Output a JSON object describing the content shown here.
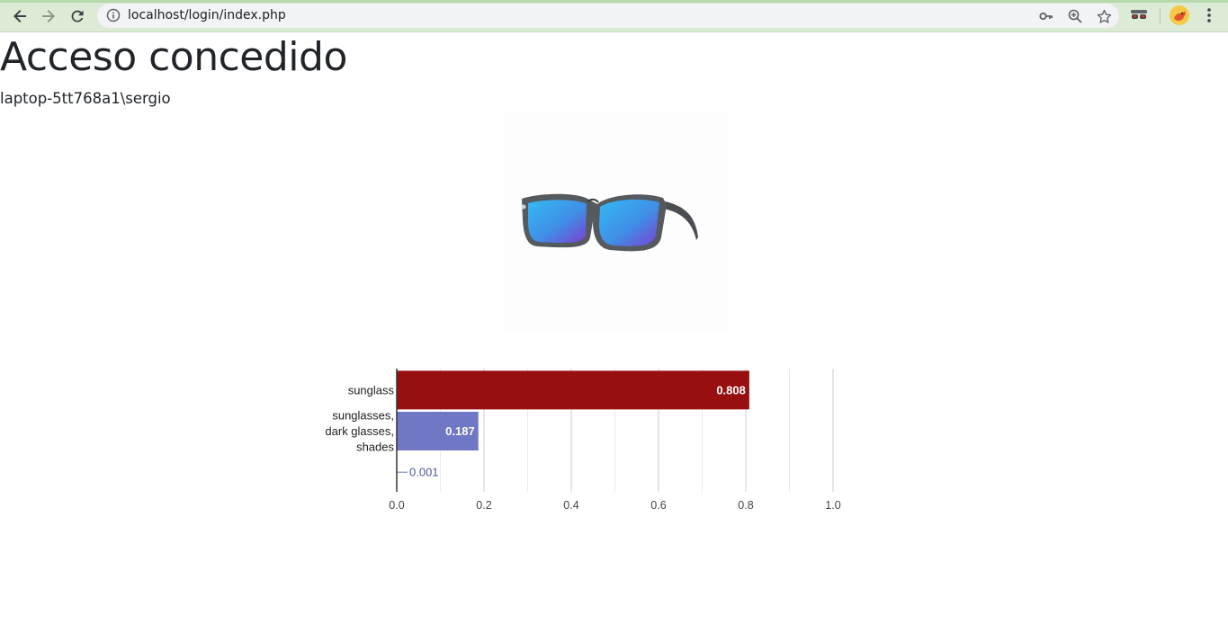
{
  "browser": {
    "url": "localhost/login/index.php",
    "icons": [
      "back-arrow-icon",
      "forward-arrow-icon",
      "reload-icon",
      "info-icon",
      "key-icon",
      "zoom-icon",
      "star-icon",
      "incognito-extension-icon",
      "profile-avatar-icon",
      "more-menu-icon"
    ]
  },
  "page": {
    "heading": "Acceso concedido",
    "username": "laptop-5tt768a1\\sergio",
    "image_subject": "sunglasses-image"
  },
  "colors": {
    "top_bar": "#980f0f",
    "other_bar": "#7077c5",
    "small_bar": "#3a4a8a"
  },
  "chart_data": {
    "type": "bar",
    "orientation": "horizontal",
    "categories": [
      [
        "sunglass"
      ],
      [
        "sunglasses,",
        "dark glasses,",
        "shades"
      ],
      [
        ""
      ]
    ],
    "values": [
      0.808,
      0.187,
      0.001
    ],
    "value_labels": [
      "0.808",
      "0.187",
      "0.001"
    ],
    "xlim": [
      0,
      1.0
    ],
    "xticks": [
      "0.0",
      "0.2",
      "0.4",
      "0.6",
      "0.8",
      "1.0"
    ],
    "grid": true,
    "legend": "none"
  }
}
